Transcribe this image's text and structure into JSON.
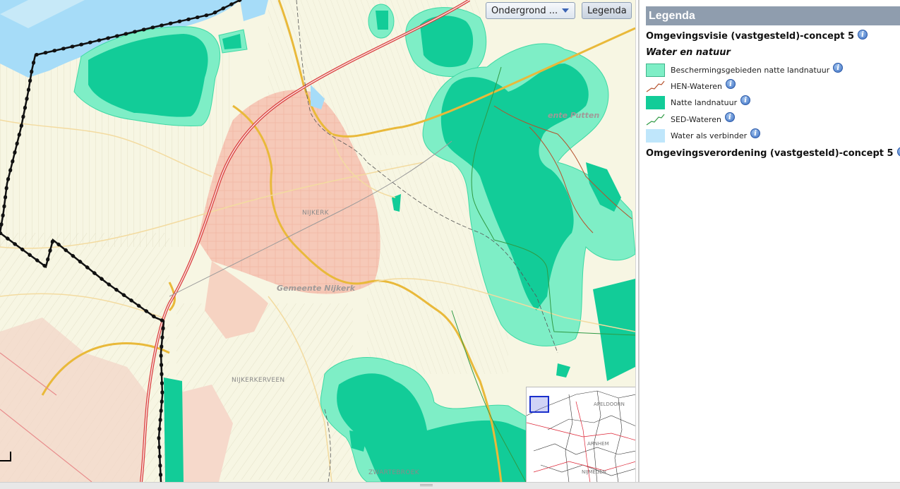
{
  "map": {
    "labels": {
      "nijkerk": "NIJKERK",
      "gemeente_nijkerk": "Gemeente  Nijkerk",
      "gemeente_putten": "ente  Putten",
      "nijkerkerveen": "NIJKERKERVEEN",
      "zwartebroek": "ZWARTEBROEK"
    },
    "colors": {
      "base": "#f7f6e3",
      "built_up": "#f6c9b8",
      "protection_zone": "#7eeec6",
      "wet_nature": "#12cc98",
      "water": "#a6dcf8",
      "road_major": "#e9b93a",
      "rail": "#d94040",
      "boundary": "#000000"
    }
  },
  "toolbar": {
    "background_label": "Ondergrond ...",
    "legend_label": "Legenda"
  },
  "overview": {
    "labels": {
      "apeldoorn": "APELDOORN",
      "arnhem": "ARNHEM",
      "nijmegen": "NIJMEGEN"
    }
  },
  "legend": {
    "title": "Legenda",
    "section1": "Omgevingsvisie (vastgesteld)-concept 5",
    "subsection": "Water en natuur",
    "items": [
      {
        "label": "Beschermingsgebieden natte landnatuur",
        "icon": "light-green-fill-swatch"
      },
      {
        "label": "HEN-Wateren",
        "icon": "brown-line-swatch"
      },
      {
        "label": "Natte landnatuur",
        "icon": "dark-green-fill-swatch"
      },
      {
        "label": "SED-Wateren",
        "icon": "green-line-swatch"
      },
      {
        "label": "Water als verbinder",
        "icon": "light-blue-fill-swatch"
      }
    ],
    "section2": "Omgevingsverordening (vastgesteld)-concept 5",
    "info_glyph": "i"
  }
}
